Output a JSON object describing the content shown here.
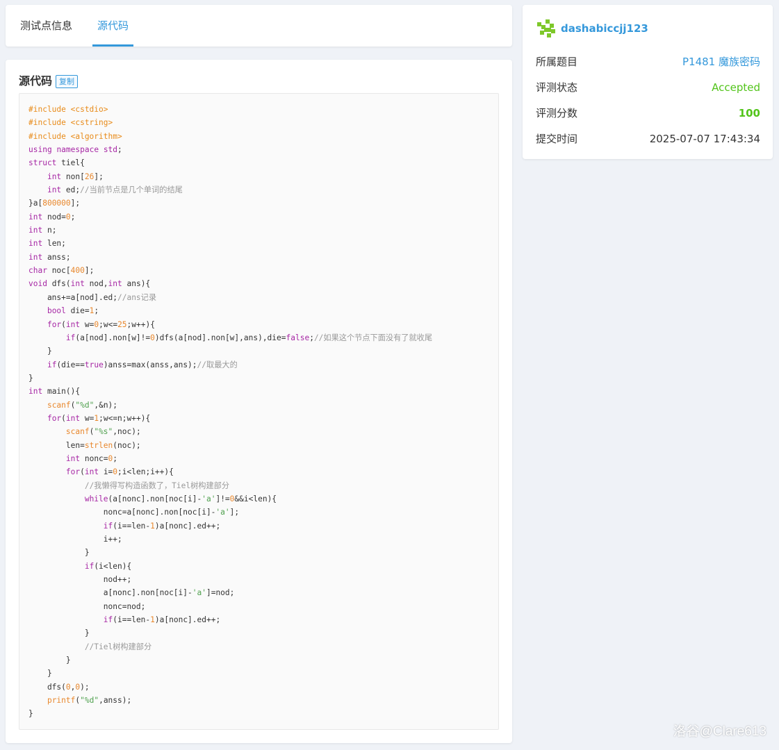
{
  "tabs": [
    {
      "label": "测试点信息"
    },
    {
      "label": "源代码"
    }
  ],
  "source": {
    "title": "源代码",
    "copy_label": "复制"
  },
  "code_lines": [
    "#include <cstdio>",
    "#include <cstring>",
    "#include <algorithm>",
    "using namespace std;",
    "struct tiel{",
    "    int non[26];",
    "    int ed;//当前节点是几个单词的结尾",
    "}a[800000];",
    "int nod=0;",
    "int n;",
    "int len;",
    "int anss;",
    "char noc[400];",
    "void dfs(int nod,int ans){",
    "    ans+=a[nod].ed;//ans记录",
    "    bool die=1;",
    "    for(int w=0;w<=25;w++){",
    "        if(a[nod].non[w]!=0)dfs(a[nod].non[w],ans),die=false;//如果这个节点下面没有了就收尾",
    "    }",
    "    if(die==true)anss=max(anss,ans);//取最大的",
    "}",
    "int main(){",
    "    scanf(\"%d\",&n);",
    "    for(int w=1;w<=n;w++){",
    "        scanf(\"%s\",noc);",
    "        len=strlen(noc);",
    "        int nonc=0;",
    "        for(int i=0;i<len;i++){",
    "            //我懒得写构造函数了，Tiel树构建部分",
    "            while(a[nonc].non[noc[i]-'a']!=0&&i<len){",
    "                nonc=a[nonc].non[noc[i]-'a'];",
    "                if(i==len-1)a[nonc].ed++;",
    "                i++;",
    "            }",
    "            if(i<len){",
    "                nod++;",
    "                a[nonc].non[noc[i]-'a']=nod;",
    "                nonc=nod;",
    "                if(i==len-1)a[nonc].ed++;",
    "            }",
    "            //Tiel树构建部分",
    "        }",
    "    }",
    "    dfs(0,0);",
    "    printf(\"%d\",anss);",
    "}"
  ],
  "info": {
    "username": "dashabiccjj123",
    "rows": [
      {
        "key": "所属题目",
        "value": "P1481 魔族密码"
      },
      {
        "key": "评测状态",
        "value": "Accepted"
      },
      {
        "key": "评测分数",
        "value": "100"
      },
      {
        "key": "提交时间",
        "value": "2025-07-07 17:43:34"
      }
    ]
  },
  "watermark": "洛谷@Clare613",
  "colors": {
    "accent": "#3498db",
    "accepted": "#52c41a",
    "avatar": "#7ec82a"
  }
}
